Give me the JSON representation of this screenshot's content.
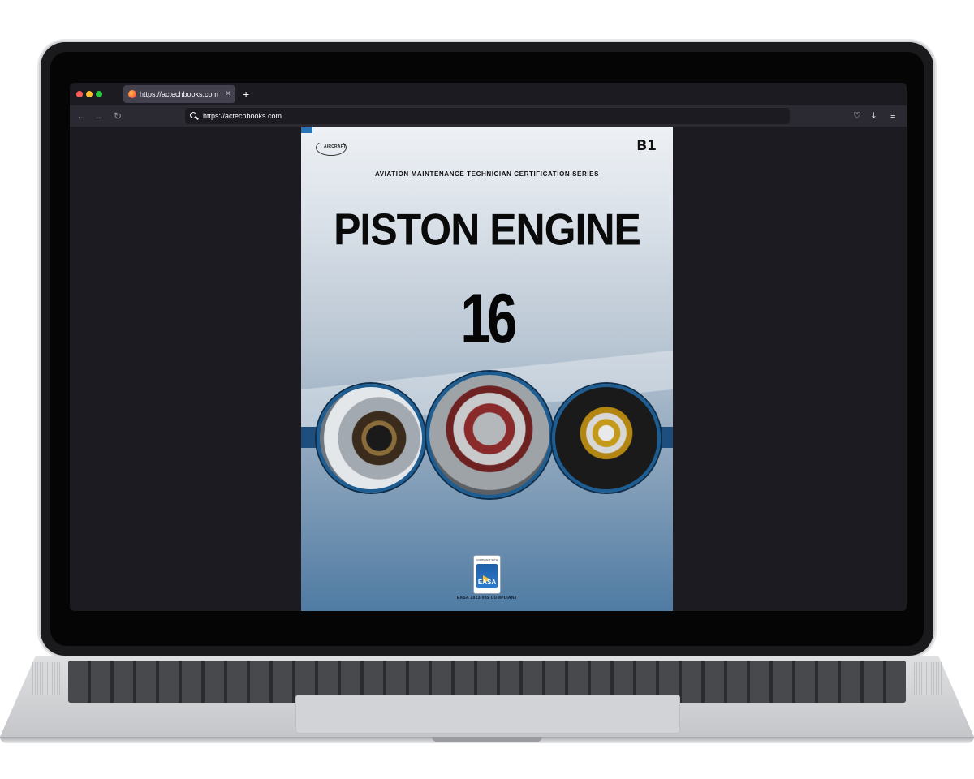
{
  "browser": {
    "tab_title": "https://actechbooks.com",
    "tab_close": "×",
    "new_tab": "+",
    "url": "https://actechbooks.com",
    "nav_back": "←",
    "nav_forward": "→",
    "nav_reload": "↻",
    "tool_pocket": "♡",
    "tool_download": "⤓",
    "tool_menu": "≡"
  },
  "cover": {
    "publisher_logo": "AIRCRAFT",
    "level": "B1",
    "series": "AVIATION MAINTENANCE TECHNICIAN CERTIFICATION SERIES",
    "title": "PISTON ENGINE",
    "module": "16",
    "badge_tag": "COMPLIANT WITH",
    "badge_word": "EASA",
    "compliance": "EASA 2023-989 COMPLIANT"
  },
  "colors": {
    "browser_bg": "#1c1b22",
    "toolbar_bg": "#2b2a33",
    "cover_accent": "#1d5d92"
  }
}
